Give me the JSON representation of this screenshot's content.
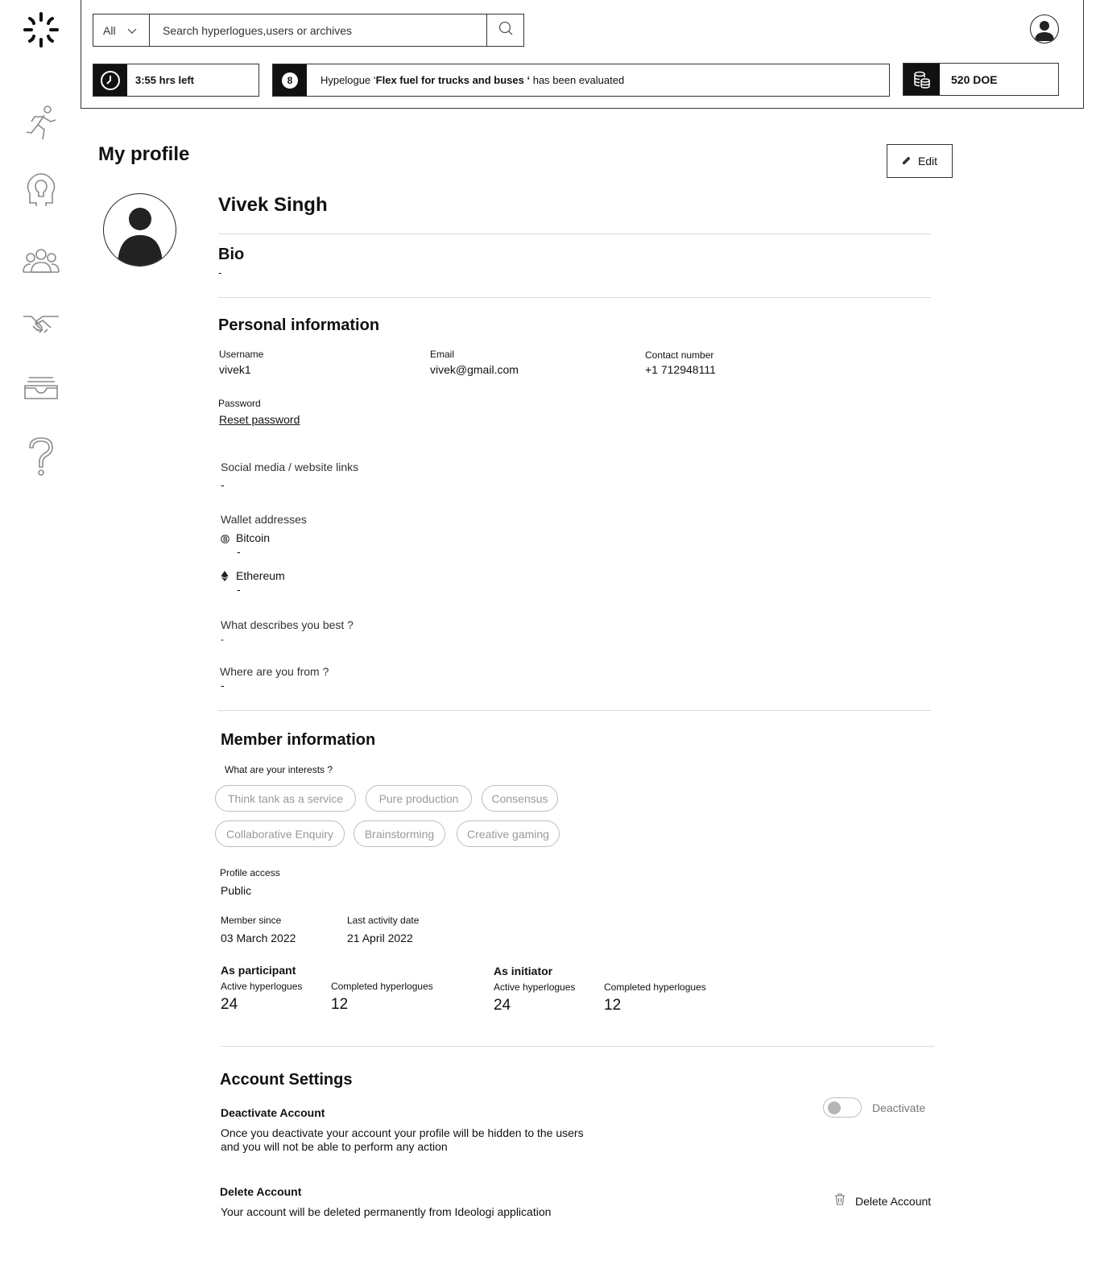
{
  "header": {
    "search": {
      "filter_value": "All",
      "placeholder": "Search hyperlogues,users or archives"
    },
    "timer": {
      "text": "3:55 hrs left"
    },
    "notification": {
      "count": "8",
      "prefix": "Hypelogue ‘",
      "title": "Flex fuel for trucks and buses ‘",
      "suffix": " has been evaluated"
    },
    "balance": {
      "text": "520 DOE"
    }
  },
  "sidebar": {
    "icons": [
      "logo-icon",
      "running-icon",
      "lightbulb-head-icon",
      "people-group-icon",
      "handshake-icon",
      "inbox-tray-icon",
      "help-icon"
    ]
  },
  "profile": {
    "page_title": "My profile",
    "edit_label": "Edit",
    "name": "Vivek Singh",
    "bio_title": "Bio",
    "bio_value": "-",
    "personal": {
      "title": "Personal information",
      "username_label": "Username",
      "username_value": "vivek1",
      "email_label": "Email",
      "email_value": "vivek@gmail.com",
      "contact_label": "Contact number",
      "contact_value": "+1 712948111",
      "password_label": "Password",
      "reset_link": "Reset password",
      "social_label": "Social media / website links",
      "social_value": "-",
      "wallet_label": "Wallet addresses",
      "bitcoin_label": "Bitcoin",
      "bitcoin_value": "-",
      "ethereum_label": "Ethereum",
      "ethereum_value": "-",
      "describe_label": "What describes you best ?",
      "describe_value": "-",
      "from_label": "Where are you from ?",
      "from_value": "-"
    },
    "member": {
      "title": "Member information",
      "interests_label": "What are your interests ?",
      "interests": [
        "Think tank as a service",
        "Pure production",
        "Consensus",
        "Collaborative Enquiry",
        "Brainstorming",
        "Creative gaming"
      ],
      "access_label": "Profile access",
      "access_value": "Public",
      "since_label": "Member since",
      "since_value": "03 March 2022",
      "last_label": "Last activity date",
      "last_value": "21 April 2022",
      "participant": {
        "title": "As participant",
        "active_label": "Active hyperlogues",
        "active_value": "24",
        "completed_label": "Completed hyperlogues",
        "completed_value": "12"
      },
      "initiator": {
        "title": "As initiator",
        "active_label": "Active hyperlogues",
        "active_value": "24",
        "completed_label": "Completed hyperlogues",
        "completed_value": "12"
      }
    },
    "account": {
      "title": "Account Settings",
      "deactivate_title": "Deactivate Account",
      "deactivate_desc_1": "Once you deactivate your account your profile will be hidden to the users",
      "deactivate_desc_2": "and you will not be able to perform any action",
      "deactivate_toggle_label": "Deactivate",
      "deactivate_on": false,
      "delete_title": "Delete Account",
      "delete_desc": "Your account will be deleted permanently from Ideologi application",
      "delete_button": "Delete Account"
    }
  }
}
